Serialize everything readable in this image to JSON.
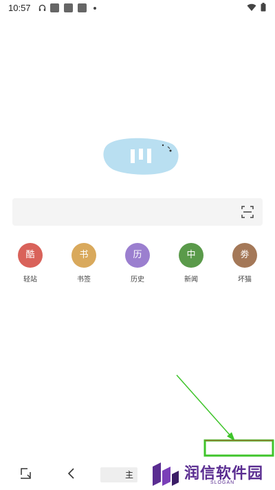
{
  "status_bar": {
    "time": "10:57",
    "icons": [
      "headphones-icon",
      "notification-square-icon",
      "notification-square-icon",
      "notification-square-icon",
      "dot-icon",
      "wifi-icon",
      "battery-icon"
    ]
  },
  "logo": {
    "icon": "app-logo-blob"
  },
  "search": {
    "placeholder": "",
    "scan_icon": "scan-icon"
  },
  "quick_links": [
    {
      "glyph": "酷",
      "label": "轻站",
      "color": "#d9625a"
    },
    {
      "glyph": "书",
      "label": "书签",
      "color": "#d9a95c"
    },
    {
      "glyph": "历",
      "label": "历史",
      "color": "#9b7fcf"
    },
    {
      "glyph": "中",
      "label": "新闻",
      "color": "#5a9a4a"
    },
    {
      "glyph": "劵",
      "label": "坏猫",
      "color": "#a47858"
    }
  ],
  "bottom_bar": {
    "home_label": "主",
    "icons": [
      "screenshot-icon",
      "back-icon"
    ]
  },
  "watermark": {
    "text": "润信软件园",
    "slogan": "SLOGAN"
  },
  "annotation": {
    "color": "#3ec42a"
  }
}
